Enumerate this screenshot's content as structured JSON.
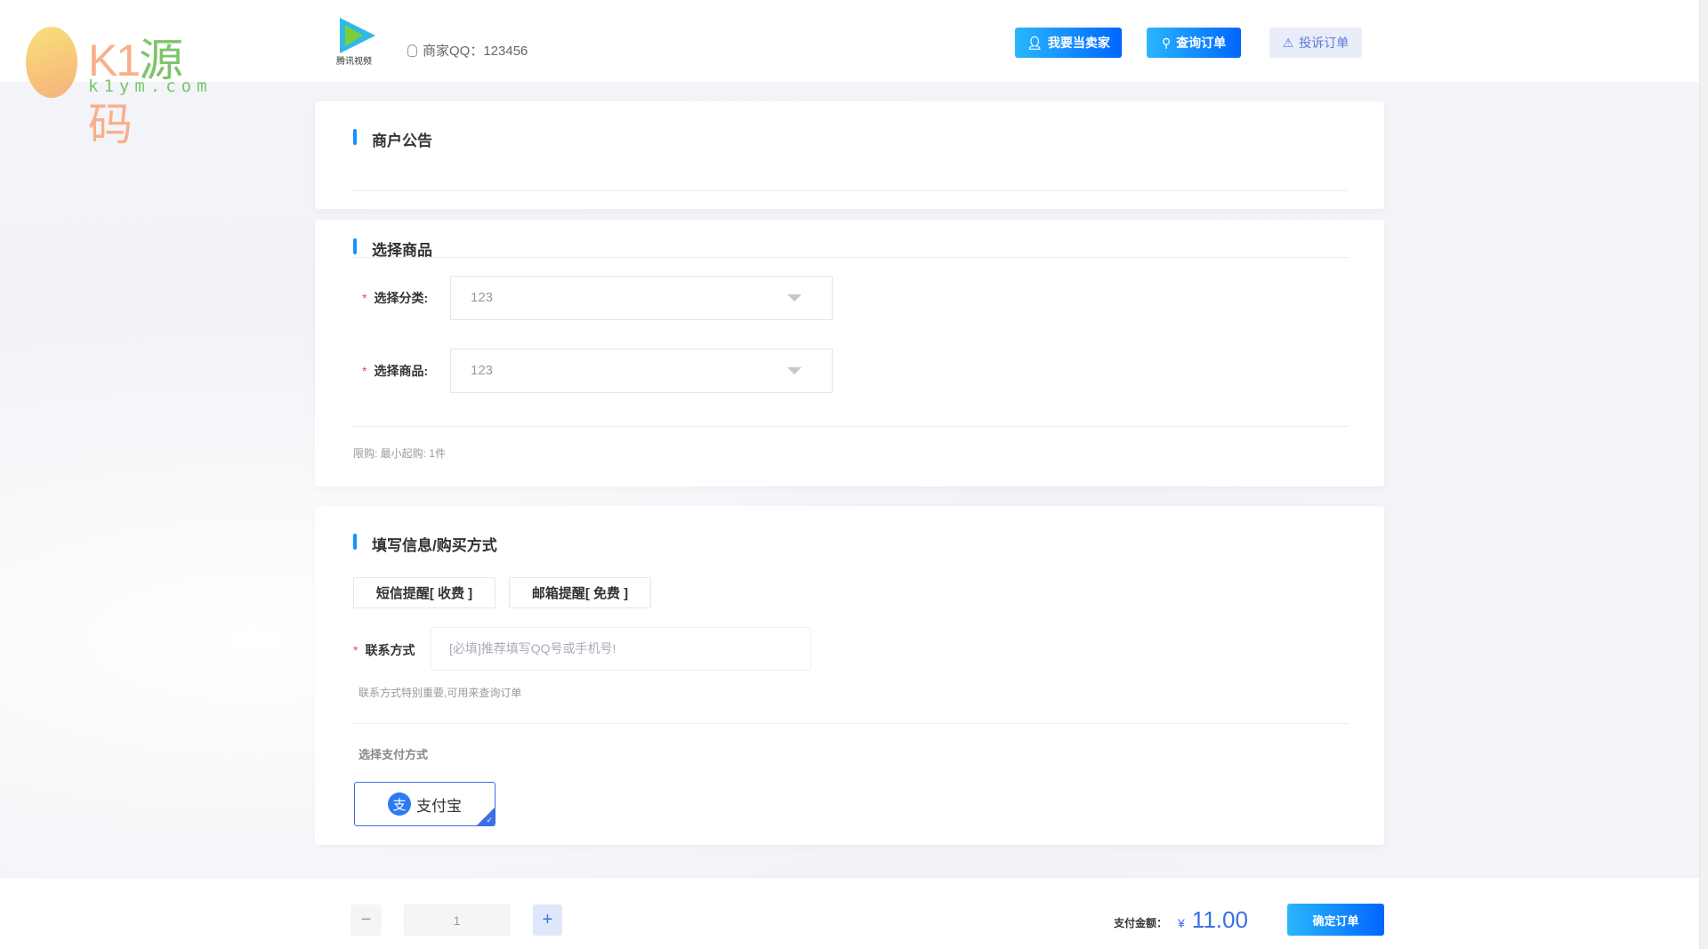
{
  "header": {
    "logo_text": "K1源码",
    "logo_url": "k1ym.com",
    "tv_logo_text": "腾讯视频",
    "merchant_qq": "商家QQ：123456",
    "buttons": [
      {
        "label": "我要当卖家",
        "icon": "user-icon"
      },
      {
        "label": "查询订单",
        "icon": "search-icon"
      },
      {
        "label": "投诉订单",
        "icon": "warning-icon"
      }
    ]
  },
  "notice": {
    "title": "商户公告"
  },
  "product": {
    "title": "选择商品",
    "category_label": "选择分类:",
    "category_value": "123",
    "product_label": "选择商品:",
    "product_value": "123",
    "limit_text": "限购:  最小起购: 1件"
  },
  "info": {
    "title": "填写信息/购买方式",
    "sms_button": "短信提醒[ 收费 ]",
    "email_button": "邮箱提醒[ 免费 ]",
    "contact_label": "联系方式",
    "contact_placeholder": "[必填]推荐填写QQ号或手机号!",
    "contact_hint": "联系方式特别重要,可用来查询订单",
    "payment_label": "选择支付方式",
    "payment_option": "支付宝",
    "payment_icon_char": "支"
  },
  "footer": {
    "minus": "−",
    "quantity": "1",
    "plus": "+",
    "amount_label": "支付金额：",
    "currency": "¥",
    "amount": "11.00",
    "confirm": "确定订单"
  },
  "colors": {
    "accent": "#1890ff",
    "price": "#3b6fe5"
  }
}
